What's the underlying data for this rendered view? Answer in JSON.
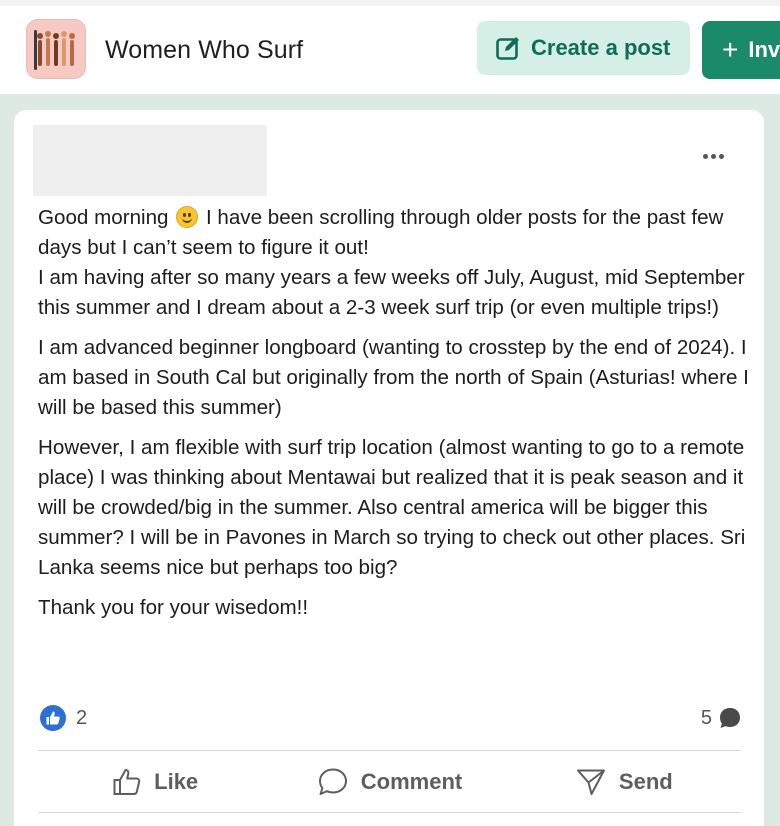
{
  "header": {
    "group_name": "Women Who Surf",
    "create_post_label": "Create a post",
    "invite_label": "Inv"
  },
  "colors": {
    "primary": "#1b8a6b",
    "primary_soft": "#d5efe6",
    "page_bg": "#dde9e3",
    "like_blue": "#2d6fd3"
  },
  "post": {
    "paragraphs": [
      {
        "before_emoji": "Good morning ",
        "after_emoji": " I have been scrolling through older posts for the past few days but I can’t seem to figure it out!",
        "line2": "I am having after so many years a few weeks off July, August, mid September this summer and I dream about a 2-3 week surf trip (or even multiple trips!)"
      }
    ],
    "p2": "I am advanced beginner longboard (wanting to crosstep by the end of 2024). I am based in South Cal but originally from the north of Spain (Asturias! where I will be based this summer)",
    "p3": "However, I am flexible with surf trip location (almost wanting to go to a remote place) I was thinking about Mentawai but realized that it is peak season and it will be crowded/big in the summer. Also central america will be bigger this summer? I will be in Pavones in March so trying to check out other places. Sri Lanka seems nice but perhaps too big?",
    "p4": "Thank you for your wisedom!!",
    "emoji": "smiling-face-icon"
  },
  "stats": {
    "likes": "2",
    "comments": "5"
  },
  "actions": {
    "like": "Like",
    "comment": "Comment",
    "send": "Send"
  },
  "icons": {
    "create": "edit-square-icon",
    "invite": "plus-icon",
    "more": "more-horizontal-icon",
    "like": "thumbs-up-icon",
    "comment": "speech-bubble-icon",
    "send": "paper-plane-icon"
  }
}
